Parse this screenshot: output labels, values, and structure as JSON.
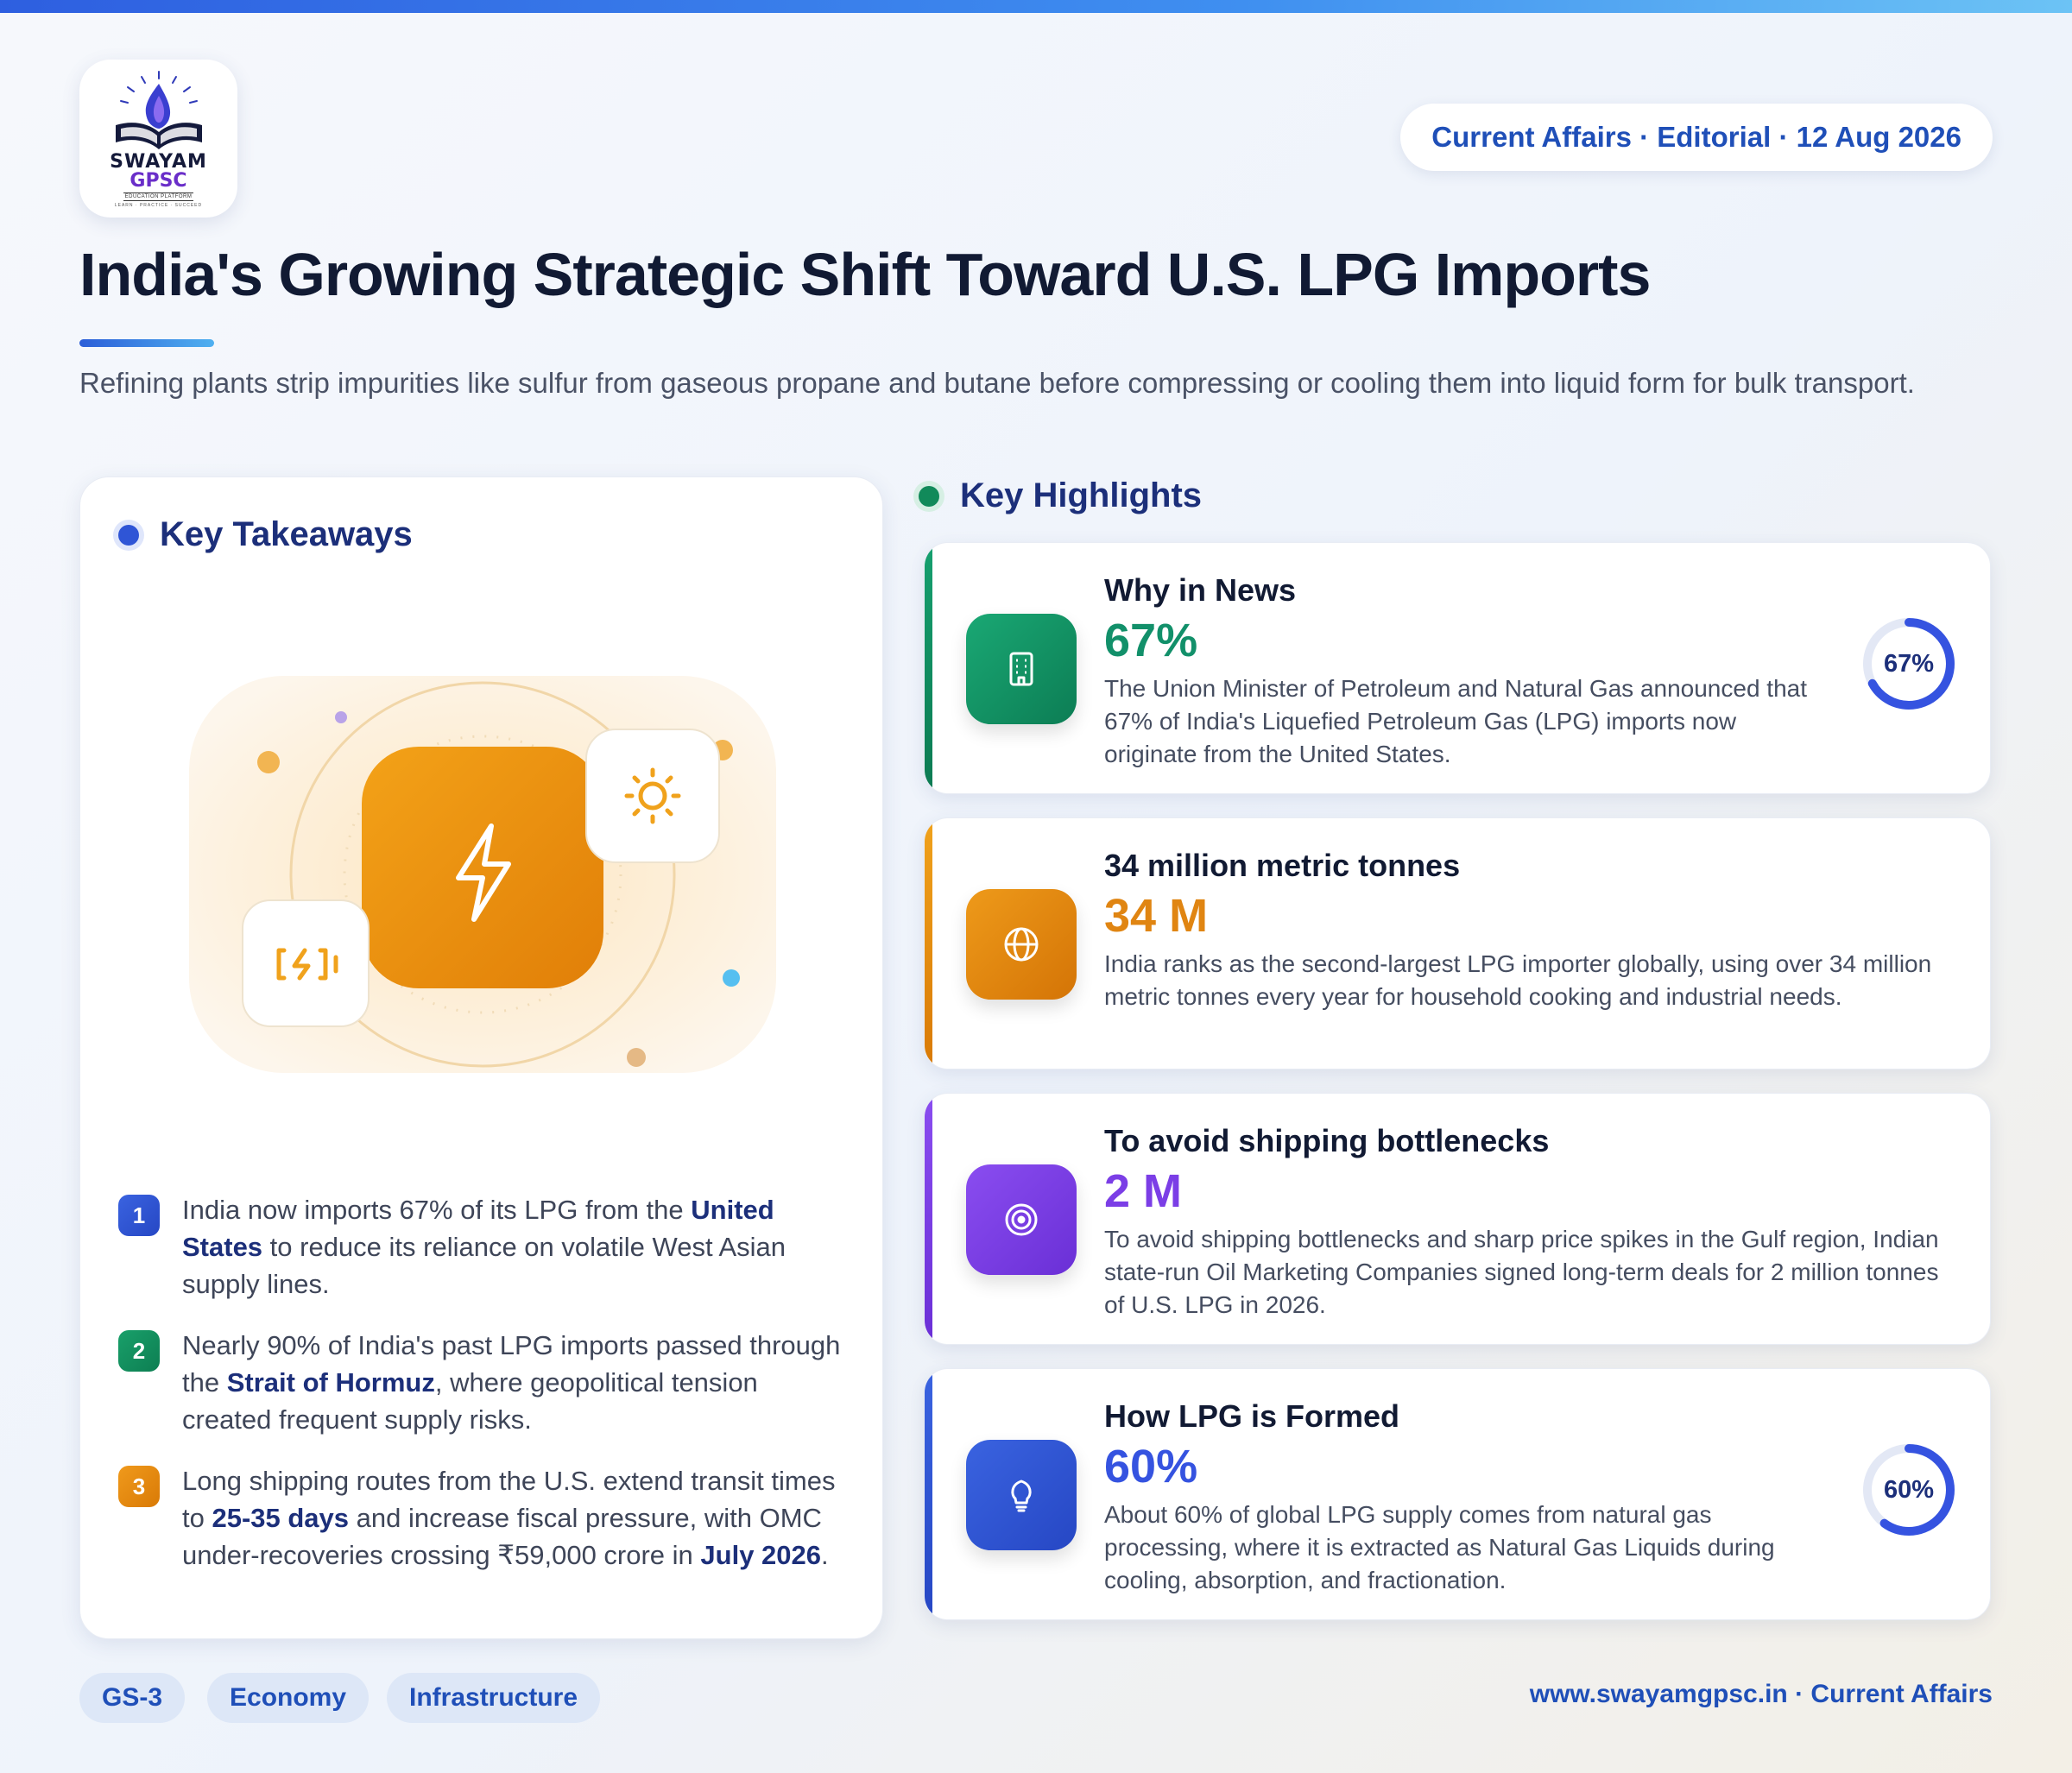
{
  "brand": {
    "name_line1": "SWAYAM",
    "name_line2": "GPSC",
    "tagline": "EDUCATION PLATFORM",
    "motto": "LEARN · PRACTICE · SUCCEED"
  },
  "header": {
    "date_chip": "Current Affairs · Editorial · 12 Aug 2026",
    "title": "India's Growing Strategic Shift Toward U.S. LPG Imports",
    "subtitle": "Refining plants strip impurities like sulfur from gaseous propane and butane before compressing or cooling them into liquid form for bulk transport."
  },
  "takeaways": {
    "heading": "Key Takeaways",
    "illustration_icons": [
      "lightning-icon",
      "sun-icon",
      "battery-charging-icon"
    ],
    "items": [
      {
        "num": "1",
        "pre": "India now imports 67% of its LPG from the ",
        "bold": "United States",
        "post": " to reduce its reliance on volatile West Asian supply lines."
      },
      {
        "num": "2",
        "pre": "Nearly 90% of India's past LPG imports passed through the ",
        "bold": "Strait of Hormuz",
        "post": ", where geopolitical tension created frequent supply risks."
      },
      {
        "num": "3",
        "pre": "Long shipping routes from the U.S. extend transit times to ",
        "bold": "25-35 days",
        "mid": " and increase fiscal pressure, with OMC under-recoveries crossing ₹59,000 crore in ",
        "bold2": "July 2026",
        "post": "."
      }
    ]
  },
  "highlights": {
    "heading": "Key Highlights",
    "cards": [
      {
        "title": "Why in News",
        "value": "67%",
        "desc": "The Union Minister of Petroleum and Natural Gas announced that 67% of India's Liquefied Petroleum Gas (LPG) imports now originate from the United States.",
        "icon": "building-icon",
        "color": "#12906a",
        "ring_label": "67%",
        "ring_fraction": 0.67
      },
      {
        "title": "34 million metric tonnes",
        "value": "34 M",
        "desc": "India ranks as the second-largest LPG importer globally, using over 34 million metric tonnes every year for household cooking and industrial needs.",
        "icon": "globe-icon",
        "color": "#e08512"
      },
      {
        "title": "To avoid shipping bottlenecks",
        "value": "2 M",
        "desc": "To avoid shipping bottlenecks and sharp price spikes in the Gulf region, Indian state-run Oil Marketing Companies signed long-term deals for 2 million tonnes of U.S. LPG in 2026.",
        "icon": "target-icon",
        "color": "#7b3ee6"
      },
      {
        "title": "How LPG is Formed",
        "value": "60%",
        "desc": "About 60% of global LPG supply comes from natural gas processing, where it is extracted as Natural Gas Liquids during cooling, absorption, and fractionation.",
        "icon": "lightbulb-icon",
        "color": "#3553e0",
        "ring_label": "60%",
        "ring_fraction": 0.6
      }
    ]
  },
  "footer": {
    "tags": [
      "GS-3",
      "Economy",
      "Infrastructure"
    ],
    "url": "www.swayamgpsc.in · Current Affairs"
  }
}
